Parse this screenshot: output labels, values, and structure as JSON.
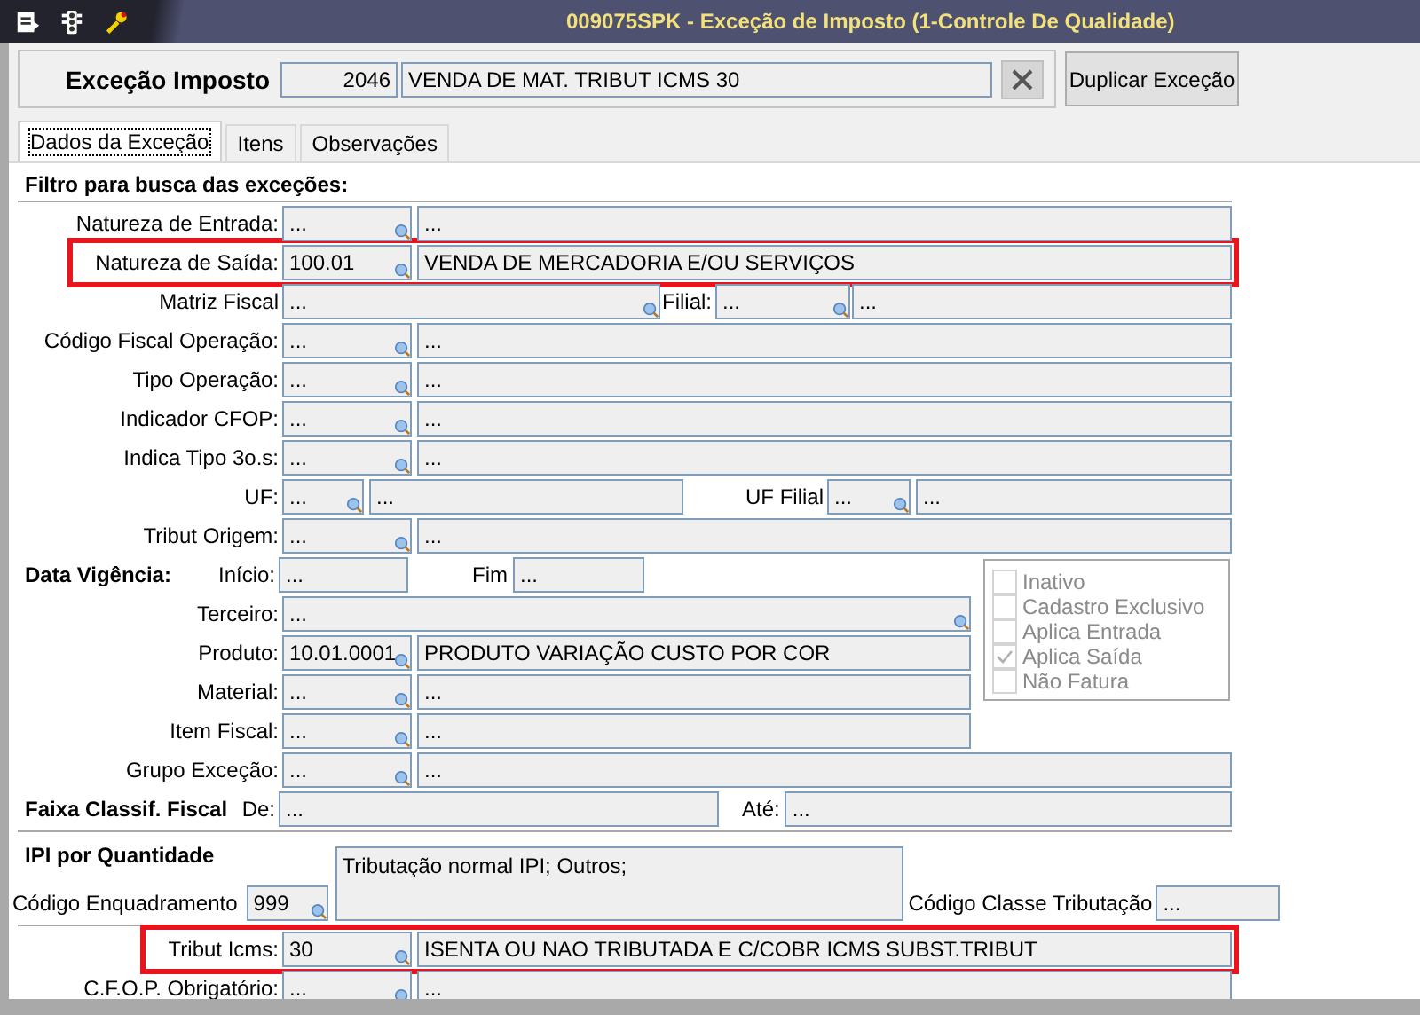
{
  "window": {
    "title": "009075SPK - Exceção de Imposto (1-Controle De Qualidade)"
  },
  "header": {
    "label": "Exceção Imposto",
    "code": "2046",
    "description": "VENDA DE MAT. TRIBUT ICMS 30",
    "button": "Duplicar Exceção"
  },
  "tabs": [
    {
      "label": "Dados da Exceção",
      "selected": true
    },
    {
      "label": "Itens",
      "selected": false
    },
    {
      "label": "Observações",
      "selected": false
    }
  ],
  "filter": {
    "title": "Filtro para busca das exceções:",
    "rows": [
      {
        "kind": "lookup",
        "label": "Natureza de Entrada:",
        "code": "...",
        "description": "...",
        "highlighted": false
      },
      {
        "kind": "lookup",
        "label": "Natureza de Saída:",
        "code": "100.01",
        "description": "VENDA DE MERCADORIA E/OU SERVIÇOS",
        "highlighted": true
      },
      {
        "kind": "split",
        "label": "Matriz Fiscal",
        "code": "...",
        "label2": "Filial:",
        "code2": "...",
        "description2": "...",
        "highlighted": false
      },
      {
        "kind": "lookup",
        "label": "Código Fiscal Operação:",
        "code": "...",
        "description": "...",
        "highlighted": false
      },
      {
        "kind": "lookup",
        "label": "Tipo Operação:",
        "code": "...",
        "description": "...",
        "highlighted": false
      },
      {
        "kind": "lookup",
        "label": "Indicador CFOP:",
        "code": "...",
        "description": "...",
        "highlighted": false
      },
      {
        "kind": "lookup",
        "label": "Indica Tipo 3o.s:",
        "code": "...",
        "description": "...",
        "highlighted": false
      },
      {
        "kind": "dual",
        "label": "UF:",
        "code": "...",
        "description": "...",
        "label2": "UF Filial",
        "code2": "...",
        "description2": "...",
        "highlighted": false
      },
      {
        "kind": "lookup",
        "label": "Tribut Origem:",
        "code": "...",
        "description": "...",
        "highlighted": false
      }
    ]
  },
  "validity": {
    "title": "Data Vigência:",
    "start_label": "Início:",
    "start": "...",
    "end_label": "Fim",
    "end": "...",
    "rows": [
      {
        "kind": "single",
        "label": "Terceiro:",
        "code": "..."
      },
      {
        "kind": "lookup",
        "label": "Produto:",
        "code": "10.01.0001",
        "description": "PRODUTO VARIAÇÃO CUSTO POR COR"
      },
      {
        "kind": "lookup",
        "label": "Material:",
        "code": "...",
        "description": "..."
      },
      {
        "kind": "lookup",
        "label": "Item Fiscal:",
        "code": "...",
        "description": "..."
      }
    ],
    "options": [
      {
        "label": "Inativo",
        "checked": false,
        "disabled": true
      },
      {
        "label": "Cadastro Exclusivo",
        "checked": false,
        "disabled": true
      },
      {
        "label": "Aplica Entrada",
        "checked": false,
        "disabled": true
      },
      {
        "label": "Aplica Saída",
        "checked": true,
        "disabled": true
      },
      {
        "label": "Não Fatura",
        "checked": false,
        "disabled": true
      }
    ]
  },
  "group_row": {
    "label": "Grupo Exceção:",
    "code": "...",
    "description": "..."
  },
  "range": {
    "title": "Faixa Classif. Fiscal",
    "from_label": "De:",
    "from": "...",
    "to_label": "Até:",
    "to": "..."
  },
  "ipi": {
    "title": "IPI por Quantidade",
    "description": "Tributação normal IPI; Outros;",
    "code_label": "Código Enquadramento",
    "code": "999",
    "class_label": "Código Classe Tributação",
    "class_code": "..."
  },
  "tax_rows": [
    {
      "label": "Tribut Icms:",
      "code": "30",
      "description": "ISENTA OU NAO TRIBUTADA E C/COBR ICMS SUBST.TRIBUT",
      "highlighted": true
    },
    {
      "label": "C.F.O.P. Obrigatório:",
      "code": "...",
      "description": "...",
      "highlighted": false
    }
  ]
}
